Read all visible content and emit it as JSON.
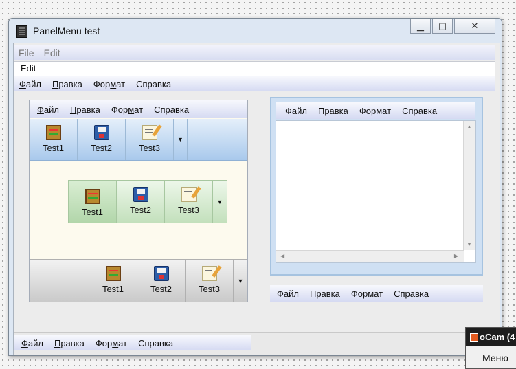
{
  "window": {
    "title": "PanelMenu test"
  },
  "main_menu": {
    "items": [
      "File",
      "Edit"
    ]
  },
  "edit_field": {
    "value": "Edit"
  },
  "ru_menu": {
    "items": [
      "Файл",
      "Правка",
      "Формат",
      "Справка"
    ]
  },
  "toolbar": {
    "buttons": [
      "Test1",
      "Test2",
      "Test3"
    ]
  },
  "icons": [
    "abacus-icon",
    "floppy-disk-icon",
    "edit-icon",
    "dropdown-arrow-icon"
  ],
  "ocam": {
    "title": "oCam (4",
    "menu": "Меню"
  }
}
